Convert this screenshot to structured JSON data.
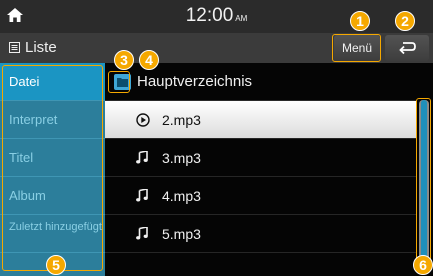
{
  "statusbar": {
    "time": "12:00",
    "ampm": "AM",
    "home_icon": "home-icon"
  },
  "header": {
    "list_label": "Liste",
    "list_icon": "list-icon",
    "menu_label": "Menü",
    "back_icon": "back-icon"
  },
  "sidebar": {
    "items": [
      {
        "label": "Datei",
        "active": true
      },
      {
        "label": "Interpret",
        "active": false
      },
      {
        "label": "Titel",
        "active": false
      },
      {
        "label": "Album",
        "active": false
      },
      {
        "label": "Zuletzt hinzugefügt",
        "active": false
      }
    ]
  },
  "content": {
    "folder_label": "Hauptverzeichnis",
    "files": [
      {
        "name": "2.mp3",
        "icon": "play-circle-icon",
        "selected": true
      },
      {
        "name": "3.mp3",
        "icon": "music-note-icon",
        "selected": false
      },
      {
        "name": "4.mp3",
        "icon": "music-note-icon",
        "selected": false
      },
      {
        "name": "5.mp3",
        "icon": "music-note-icon",
        "selected": false
      }
    ]
  },
  "callouts": [
    "1",
    "2",
    "3",
    "4",
    "5",
    "6"
  ],
  "colors": {
    "accent": "#1b95c3",
    "callout": "#f5a800",
    "sidebar": "#2c7e9b"
  }
}
